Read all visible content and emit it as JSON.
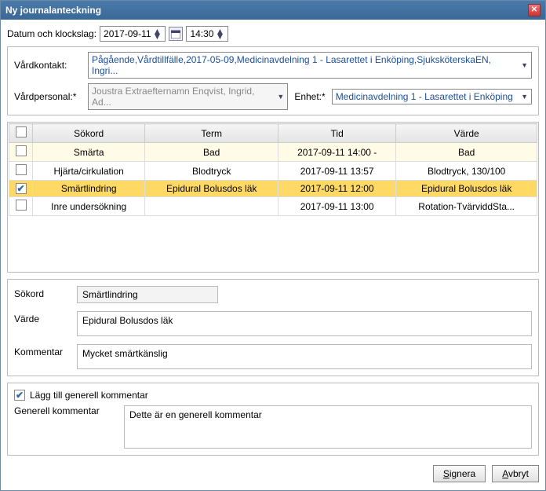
{
  "title": "Ny journalanteckning",
  "datetime_label": "Datum och klockslag:",
  "date_value": "2017-09-11",
  "time_value": "14:30",
  "contact_label": "Vårdkontakt:",
  "contact_value": "Pågående,Vårdtillfälle,2017-05-09,Medicinavdelning 1 - Lasarettet i Enköping,SjuksköterskaEN, Ingri...",
  "staff_label": "Vårdpersonal:*",
  "staff_value": "Joustra Extraefternamn Enqvist, Ingrid, Ad...",
  "unit_label": "Enhet:*",
  "unit_value": "Medicinavdelning 1 - Lasarettet i Enköping",
  "headers": {
    "sokord": "Sökord",
    "term": "Term",
    "tid": "Tid",
    "varde": "Värde"
  },
  "rows": [
    {
      "checked": false,
      "sokord": "Smärta",
      "term": "Bad",
      "tid": "2017-09-11 14:00 -",
      "varde": "Bad",
      "rowclass": "first"
    },
    {
      "checked": false,
      "sokord": "Hjärta/cirkulation",
      "term": "Blodtryck",
      "tid": "2017-09-11 13:57",
      "varde": "Blodtryck, 130/100",
      "rowclass": ""
    },
    {
      "checked": true,
      "sokord": "Smärtlindring",
      "term": "Epidural Bolusdos läk",
      "tid": "2017-09-11 12:00",
      "varde": "Epidural Bolusdos läk",
      "rowclass": "sel"
    },
    {
      "checked": false,
      "sokord": "Inre undersökning",
      "term": "",
      "tid": "2017-09-11 13:00",
      "varde": "Rotation-TvärviddSta...",
      "rowclass": ""
    }
  ],
  "detail": {
    "sokord_label": "Sökord",
    "sokord_value": "Smärtlindring",
    "varde_label": "Värde",
    "varde_value": "Epidural Bolusdos läk",
    "komm_label": "Kommentar",
    "komm_value": "Mycket smärtkänslig"
  },
  "add_generic_label": "Lägg till generell kommentar",
  "add_generic_checked": true,
  "gen_label": "Generell kommentar",
  "gen_value": "Dette är en generell kommentar",
  "btn_sign": "Signera",
  "btn_cancel": "Avbryt"
}
